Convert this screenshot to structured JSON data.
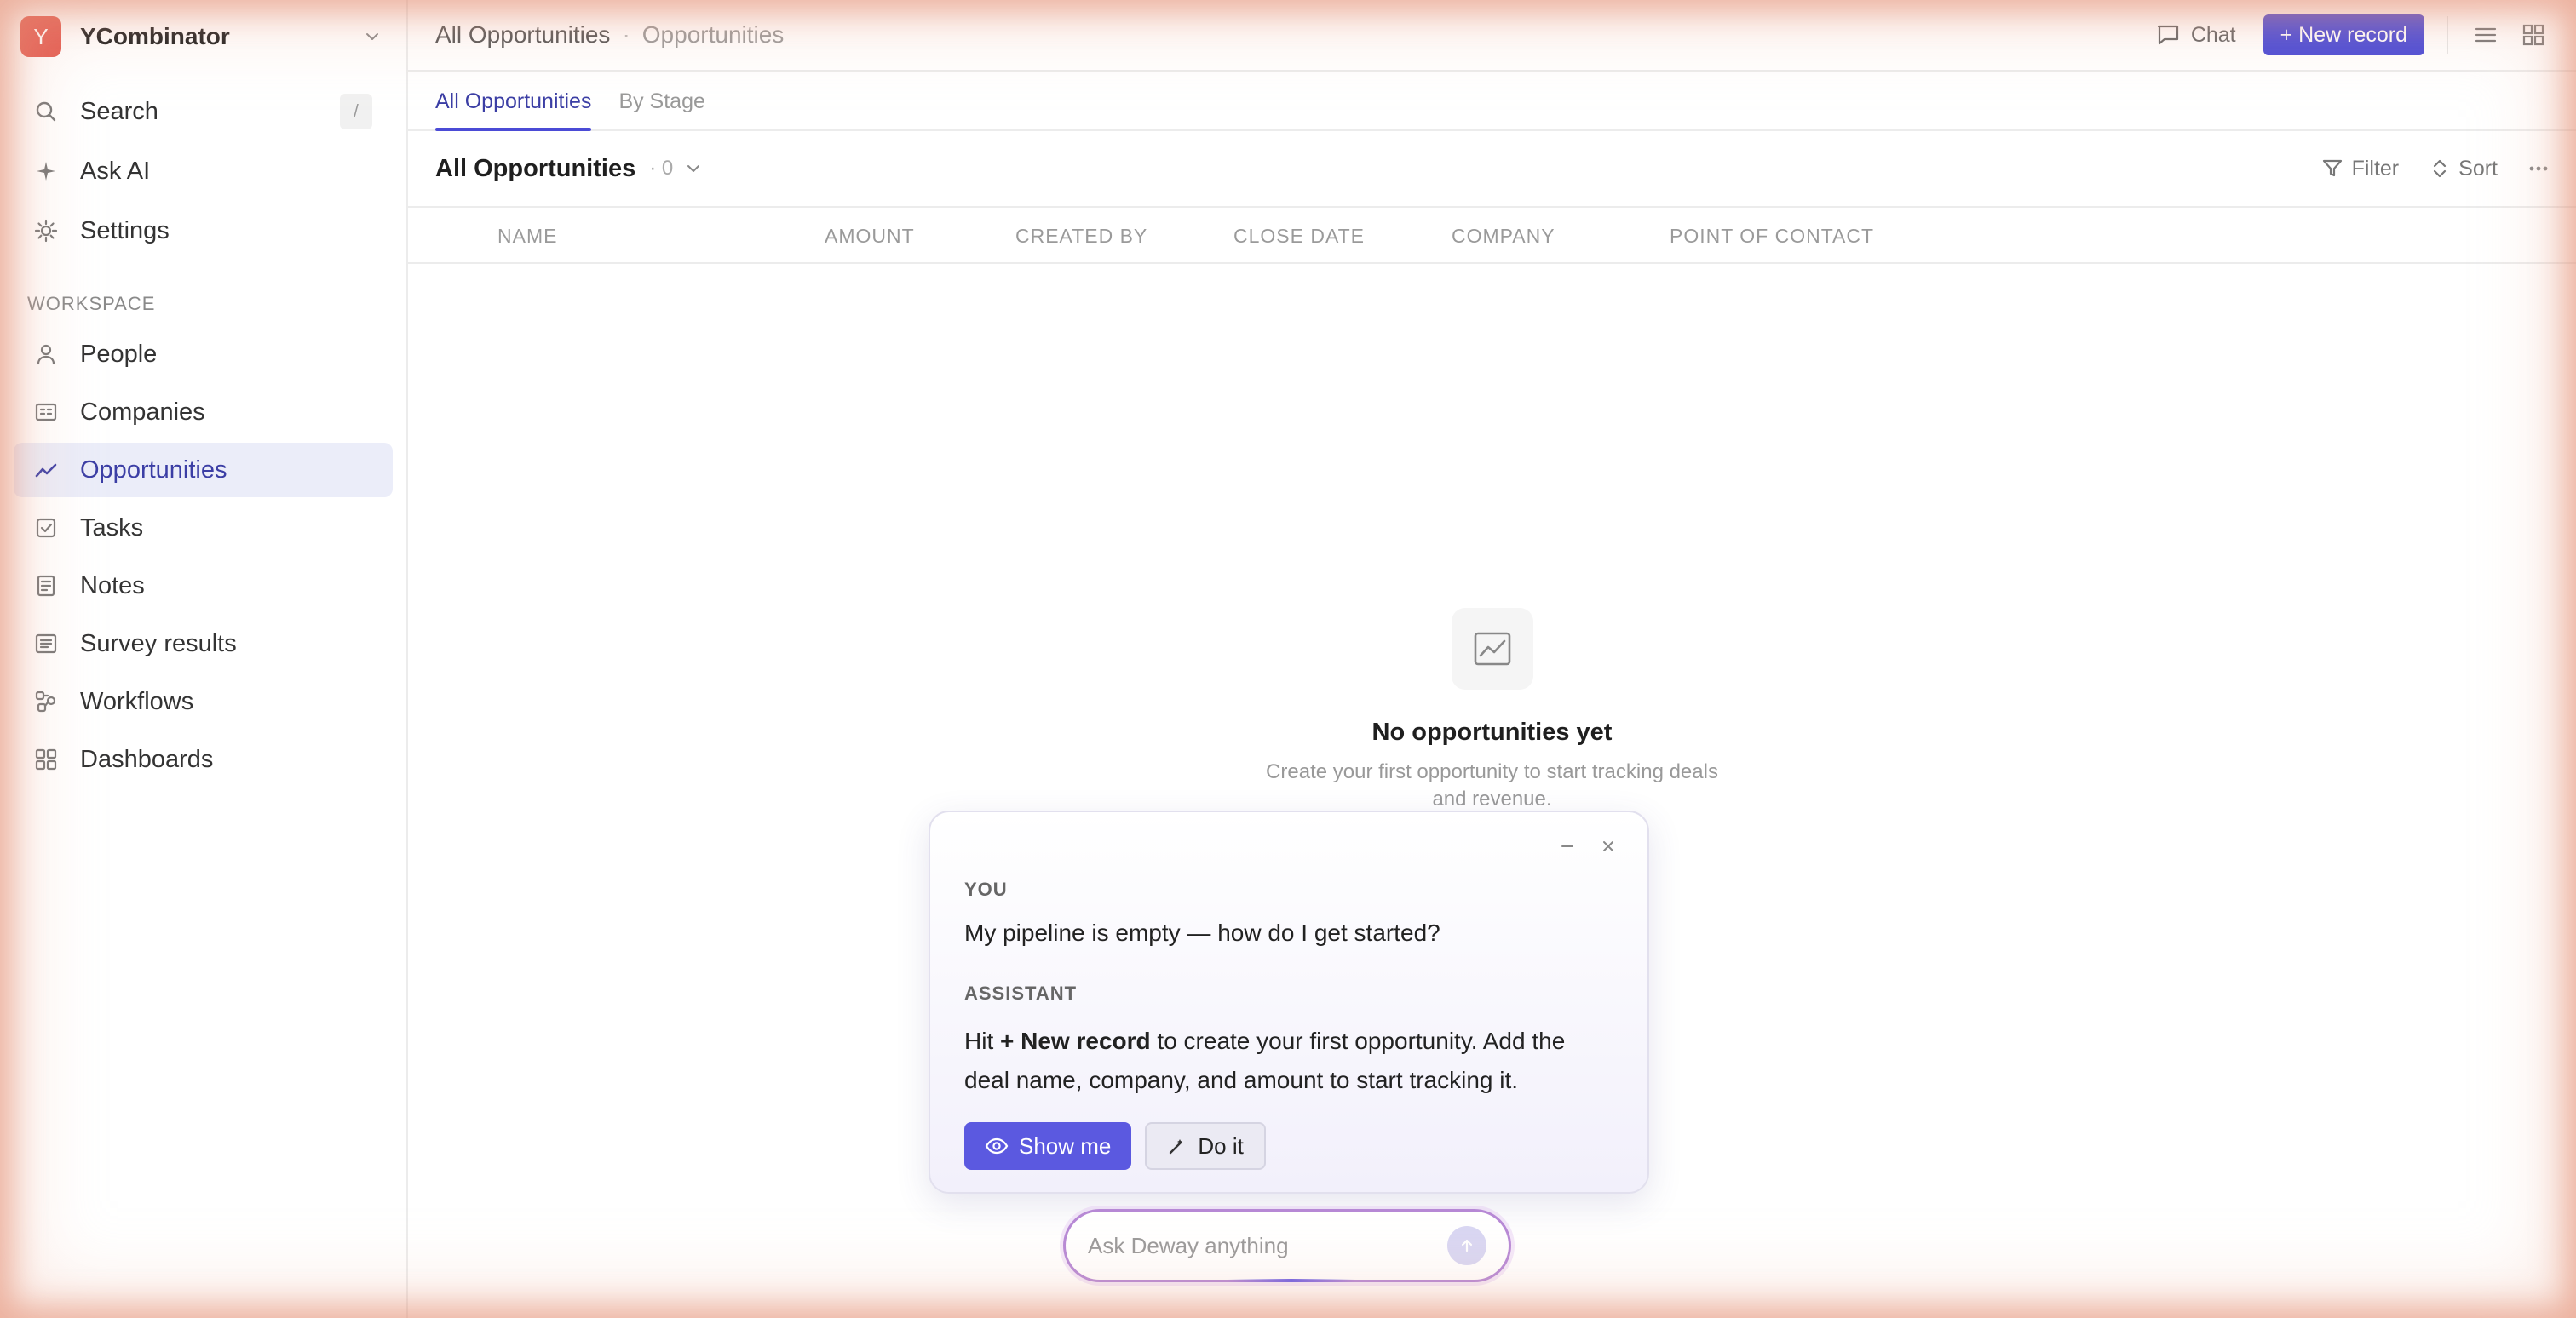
{
  "workspace": {
    "initial": "Y",
    "name": "YCombinator"
  },
  "nav": {
    "search_label": "Search",
    "search_shortcut": "/",
    "ask_ai_label": "Ask AI",
    "settings_label": "Settings"
  },
  "workspace_section": {
    "label": "WORKSPACE",
    "items": [
      {
        "label": "People",
        "icon": "person-icon"
      },
      {
        "label": "Companies",
        "icon": "building-icon"
      },
      {
        "label": "Opportunities",
        "icon": "trend-chart-icon",
        "active": true
      },
      {
        "label": "Tasks",
        "icon": "checkbox-icon"
      },
      {
        "label": "Notes",
        "icon": "note-icon"
      },
      {
        "label": "Survey results",
        "icon": "list-icon"
      },
      {
        "label": "Workflows",
        "icon": "workflow-icon"
      },
      {
        "label": "Dashboards",
        "icon": "dashboard-icon"
      }
    ]
  },
  "topbar": {
    "breadcrumb_primary": "All Opportunities",
    "breadcrumb_separator": "·",
    "breadcrumb_secondary": "Opportunities",
    "chat_label": "Chat",
    "new_record_label": "+ New record"
  },
  "tabs": [
    {
      "label": "All Opportunities",
      "active": true
    },
    {
      "label": "By Stage",
      "active": false
    }
  ],
  "view": {
    "title": "All Opportunities",
    "count": "· 0",
    "filter_label": "Filter",
    "sort_label": "Sort"
  },
  "table": {
    "columns": [
      "NAME",
      "AMOUNT",
      "CREATED BY",
      "CLOSE DATE",
      "COMPANY",
      "POINT OF CONTACT"
    ],
    "rows": []
  },
  "empty_state": {
    "title": "No opportunities yet",
    "subtitle": "Create your first opportunity to start tracking deals and revenue."
  },
  "assistant": {
    "you_label": "YOU",
    "you_message": "My pipeline is empty — how do I get started?",
    "assistant_label": "ASSISTANT",
    "assistant_prefix": "Hit ",
    "assistant_bold": "+ New record",
    "assistant_suffix": " to create your first opportunity. Add the deal name, company, and amount to start tracking it.",
    "show_me_label": "Show me",
    "do_it_label": "Do it"
  },
  "ask_bar": {
    "placeholder": "Ask Deway anything"
  },
  "colors": {
    "accent": "#4b4bd6",
    "workspace_avatar": "#e35a4f",
    "active_nav_bg": "#ebedf9",
    "ask_border": "#b789d6"
  }
}
